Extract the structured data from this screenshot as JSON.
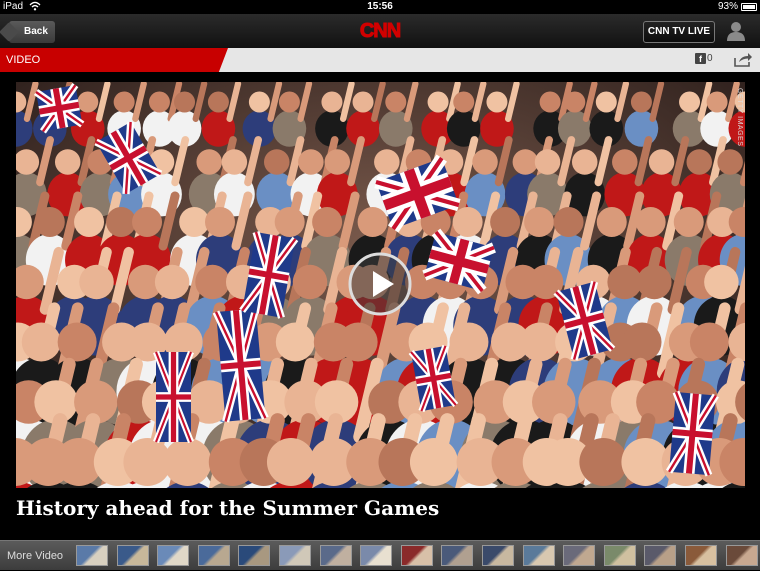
{
  "status_bar": {
    "carrier": "iPad",
    "time": "15:56",
    "battery_pct": "93%"
  },
  "nav": {
    "back_label": "Back",
    "logo_text": "CNN",
    "tv_live_label": "CNN TV LIVE"
  },
  "section": {
    "label": "VIDEO",
    "facebook_count": "0"
  },
  "video": {
    "credit": "GETTY IMAGES",
    "headline": "History ahead for the Summer Games"
  },
  "bottom_bar": {
    "more_video_label": "More Video",
    "thumbnail_count": 17
  },
  "colors": {
    "brand_red": "#c80000",
    "logo_red": "#d10000"
  },
  "icons": [
    "wifi-icon",
    "battery-icon",
    "back-arrow-icon",
    "user-icon",
    "facebook-icon",
    "share-icon",
    "play-icon"
  ]
}
